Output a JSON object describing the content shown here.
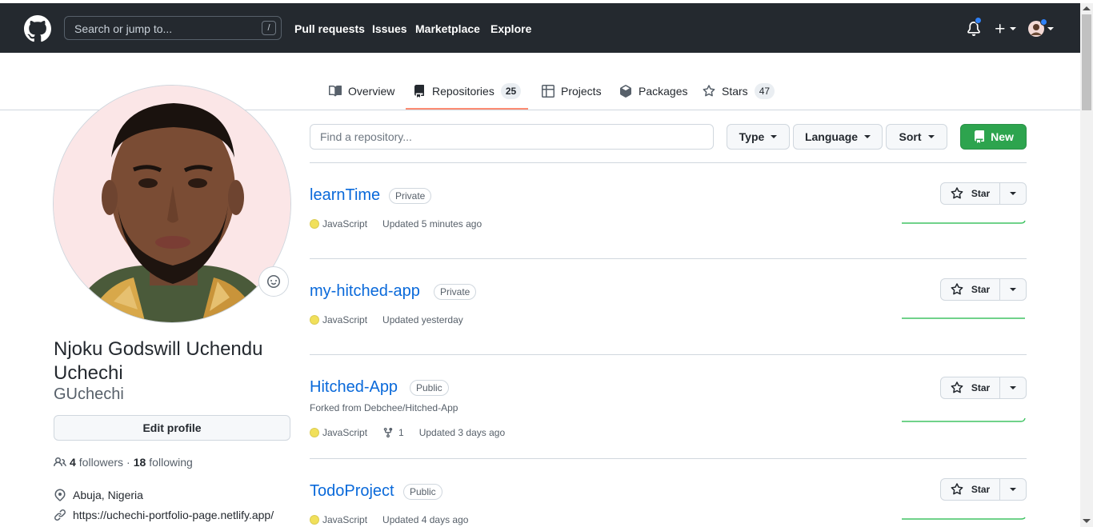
{
  "header": {
    "search_placeholder": "Search or jump to...",
    "search_shortcut": "/",
    "nav": [
      "Pull requests",
      "Issues",
      "Marketplace",
      "Explore"
    ],
    "icons": [
      "github-logo-icon",
      "bell-icon",
      "plus-icon",
      "avatar-menu"
    ]
  },
  "tabs": [
    {
      "label": "Overview",
      "icon": "book-icon"
    },
    {
      "label": "Repositories",
      "icon": "repo-icon",
      "count": "25",
      "selected": true
    },
    {
      "label": "Projects",
      "icon": "table-icon"
    },
    {
      "label": "Packages",
      "icon": "package-icon"
    },
    {
      "label": "Stars",
      "icon": "star-icon",
      "count": "47"
    }
  ],
  "profile": {
    "fullname": "Njoku Godswill Uchendu Uchechi",
    "username": "GUchechi",
    "edit_label": "Edit profile",
    "followers": "4",
    "followers_label": "followers",
    "following": "18",
    "following_label": "following",
    "separator": "·",
    "location": "Abuja, Nigeria",
    "website": "https://uchechi-portfolio-page.netlify.app/"
  },
  "filters": {
    "find_placeholder": "Find a repository...",
    "type_label": "Type",
    "language_label": "Language",
    "sort_label": "Sort",
    "new_label": "New"
  },
  "repos": [
    {
      "name": "learnTime",
      "visibility": "Private",
      "language": "JavaScript",
      "updated": "Updated 5 minutes ago",
      "star_label": "Star"
    },
    {
      "name": "my-hitched-app",
      "visibility": "Private",
      "language": "JavaScript",
      "updated": "Updated yesterday",
      "star_label": "Star"
    },
    {
      "name": "Hitched-App",
      "visibility": "Public",
      "forked_from": "Forked from Debchee/Hitched-App",
      "language": "JavaScript",
      "forks": "1",
      "updated": "Updated 3 days ago",
      "star_label": "Star"
    },
    {
      "name": "TodoProject",
      "visibility": "Public",
      "language": "JavaScript",
      "updated": "Updated 4 days ago",
      "star_label": "Star"
    }
  ],
  "colors": {
    "header_bg": "#24292f",
    "link": "#0969da",
    "new_button": "#2da44e",
    "javascript": "#f1e05a",
    "tab_underline": "#fd8c73"
  }
}
